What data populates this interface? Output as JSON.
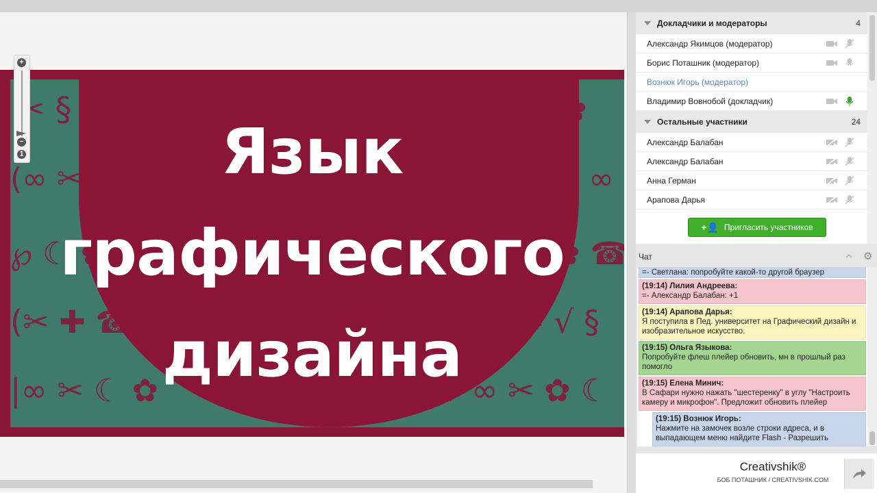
{
  "slide": {
    "title_lines": [
      "Язык",
      "графического",
      "дизайна"
    ],
    "colors": {
      "frame": "#8a1538",
      "pattern_bg": "#3f7a6a"
    }
  },
  "zoom": {
    "plus": "+",
    "minus": "−",
    "one": "1"
  },
  "participants": {
    "presenters_group": {
      "label": "Докладчики и модераторы",
      "count": "4"
    },
    "presenters": [
      {
        "name": "Александр Якимцов (модератор)",
        "cam": "camera-icon",
        "mic": "mic-muted-icon"
      },
      {
        "name": "Борис Поташник (модератор)",
        "cam": "camera-icon",
        "mic": "mic-icon"
      },
      {
        "name": "Вознюк Игорь (модератор)",
        "active": true
      },
      {
        "name": "Владимир Вовнобой (докладчик)",
        "cam": "camera-icon",
        "mic": "mic-active-icon"
      }
    ],
    "others_group": {
      "label": "Остальные участники",
      "count": "24"
    },
    "others": [
      {
        "name": "Александр Балабан"
      },
      {
        "name": "Александр Балабан"
      },
      {
        "name": "Анна Герман"
      },
      {
        "name": "Арапова Дарья"
      }
    ],
    "invite_label": "Пригласить участников"
  },
  "chat": {
    "title": "Чат",
    "messages": [
      {
        "text": "=- Светлана: попробуйте какой-то другой браузер",
        "color": "blue"
      },
      {
        "who": "(19:14) Лилия Андреева:",
        "text": "=- Александр Балабан: +1",
        "color": "pink"
      },
      {
        "who": "(19:14) Арапова Дарья:",
        "text": "Я поступила в Пед. университет на Графический дизайн и изобразительное искусство.",
        "color": "yellow"
      },
      {
        "who": "(19:15) Ольга Языкова:",
        "text": "Попробуйте флеш плейер обновить, мн в прошлый раз помогло",
        "color": "green"
      },
      {
        "who": "(19:15) Елена  Минич:",
        "text": "В Сафари нужно нажать \"шестеренку\" в углу \"Настроить камеру и микрофон\". Предложит обновить плейер",
        "color": "pink"
      },
      {
        "who": "(19:15) Вознюк Игорь:",
        "text": "Нажмите на замочек возле строки адреса, и в выпадающем меню найдите Flash - Разрешить",
        "color": "blue"
      }
    ]
  },
  "footer": {
    "brand": "Creativshik®",
    "sub": "БОБ ПОТАШНИК / CREATIVSHIK.COM"
  }
}
